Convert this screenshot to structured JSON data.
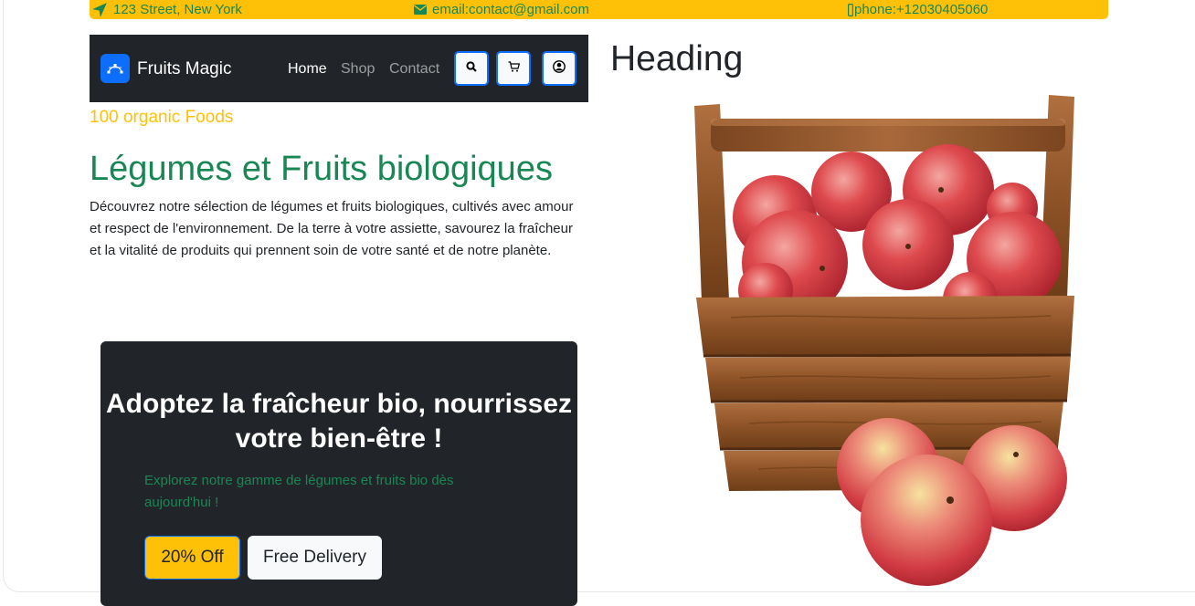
{
  "topbar": {
    "address": "123 Street, New York",
    "email": "email:contact@gmail.com",
    "phone": "phone:+12030405060",
    "background": "#ffc107",
    "text_color": "#198754",
    "icons": [
      "location-arrow-icon",
      "envelope-icon",
      "phone-icon"
    ]
  },
  "navbar": {
    "brand": "Fruits Magic",
    "brand_logo_icon": "bezier-curve-icon",
    "links": [
      {
        "label": "Home",
        "active": true
      },
      {
        "label": "Shop",
        "active": false
      },
      {
        "label": "Contact",
        "active": false
      }
    ],
    "buttons": [
      "search-icon",
      "cart-icon",
      "user-icon"
    ],
    "background": "#212529"
  },
  "hero": {
    "tagline": "100 organic Foods",
    "title": "Légumes et Fruits biologiques",
    "description": "Découvrez notre sélection de légumes et fruits biologiques, cultivés avec amour et respect de l'environnement. De la terre à votre assiette, savourez la fraîcheur et la vitalité de produits qui prennent soin de votre santé et de notre planète."
  },
  "promo": {
    "title": "Adoptez la fraîcheur bio, nourrissez votre bien-être !",
    "text": "Explorez notre gamme de légumes et fruits bio dès aujourd'hui !",
    "button_off": "20% Off",
    "button_delivery": "Free Delivery"
  },
  "right": {
    "heading": "Heading",
    "image_icon": "apple-basket-image"
  },
  "colors": {
    "accent_yellow": "#ffc107",
    "accent_green": "#198754",
    "brand_blue": "#0d6efd",
    "dark": "#212529"
  }
}
